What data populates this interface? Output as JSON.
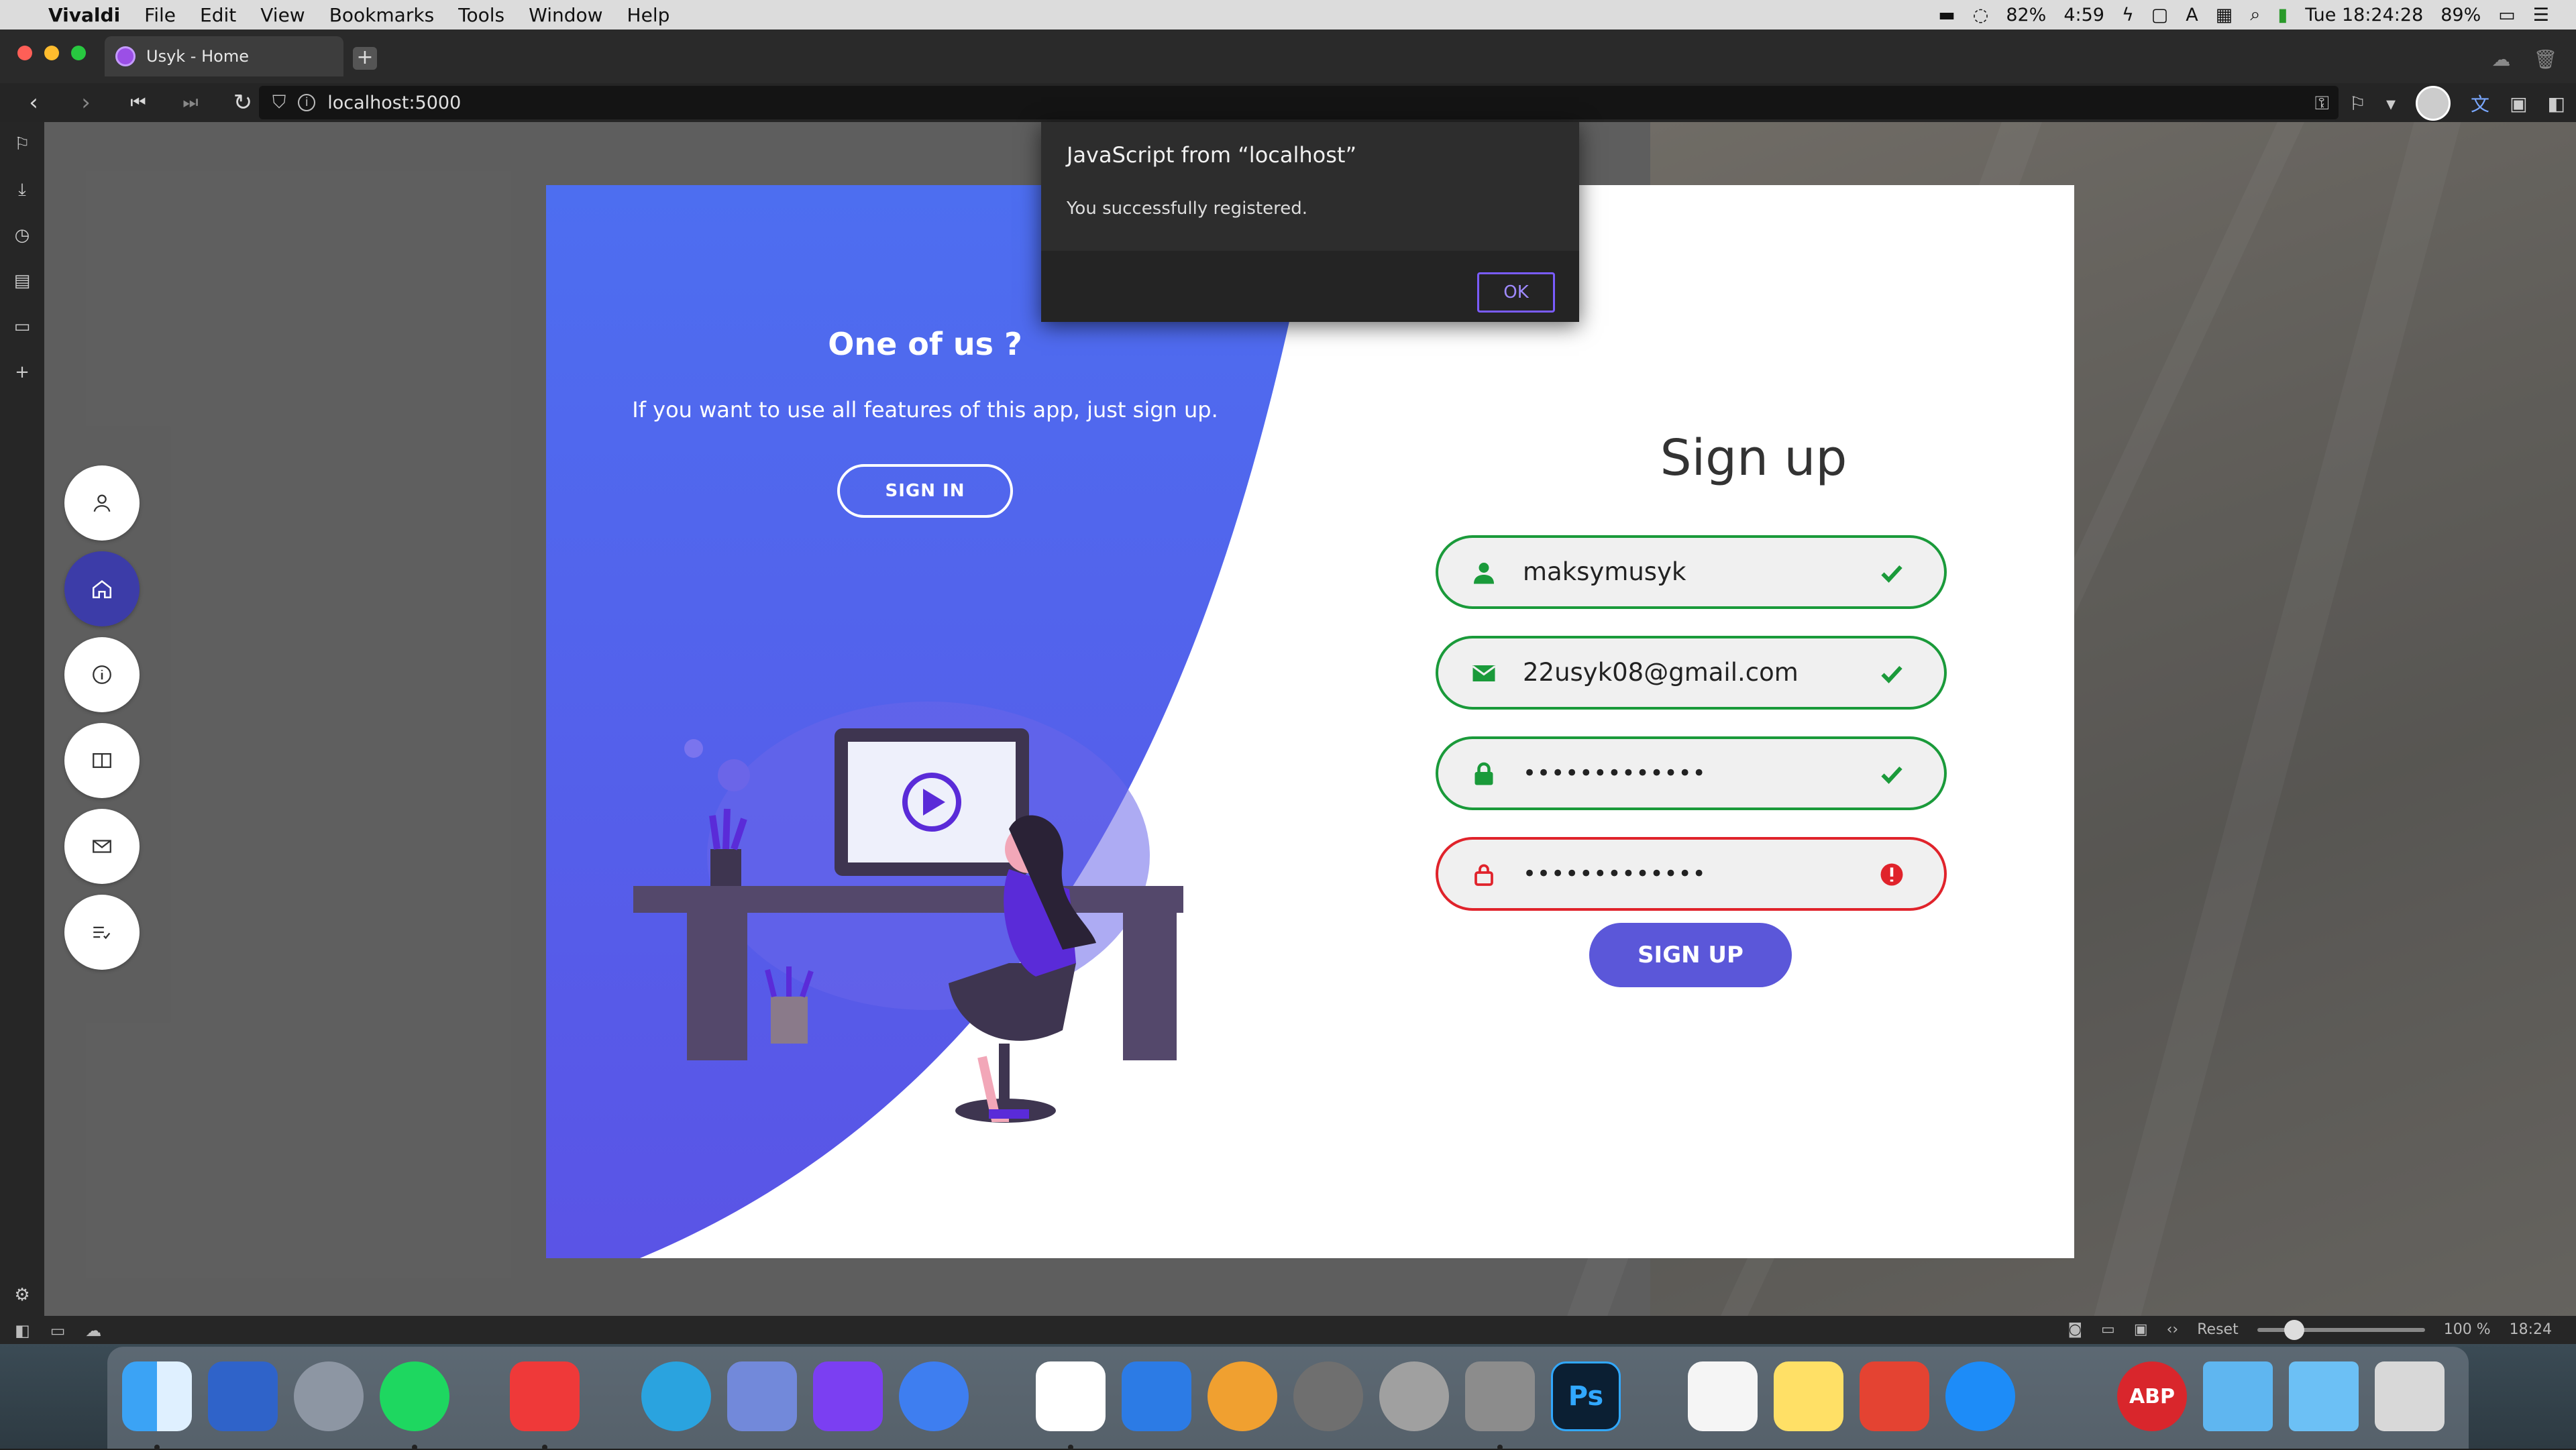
{
  "menubar": {
    "app_name": "Vivaldi",
    "menus": [
      "File",
      "Edit",
      "View",
      "Bookmarks",
      "Tools",
      "Window",
      "Help"
    ],
    "status": {
      "battery_left": "82%",
      "clock_small": "4:59",
      "datetime": "Tue 18:24:28",
      "battery": "89%"
    }
  },
  "browser": {
    "tab_title": "Usyk - Home",
    "url": "localhost:5000",
    "status_reset": "Reset",
    "zoom": "100 %",
    "status_time": "18:24"
  },
  "page": {
    "left_title": "One of us ?",
    "left_subtitle": "If you want to use all features of this app, just sign up.",
    "signin_label": "SIGN IN",
    "signup_title": "Sign up",
    "username_value": "maksymusyk",
    "email_value": "22usyk08@gmail.com",
    "password_value": "•••••••••••••",
    "confirm_password_value": "•••••••••••••",
    "signup_label": "SIGN UP"
  },
  "alert": {
    "title": "JavaScript from “localhost”",
    "message": "You successfully registered.",
    "ok_label": "OK"
  },
  "dock": {
    "photoshop_label": "Ps",
    "abp_label": "ABP"
  },
  "colors": {
    "accent_blue": "#4d6ef0",
    "button_purple": "#5b57d9",
    "valid_green": "#1a9a3a",
    "error_red": "#e0232b"
  }
}
